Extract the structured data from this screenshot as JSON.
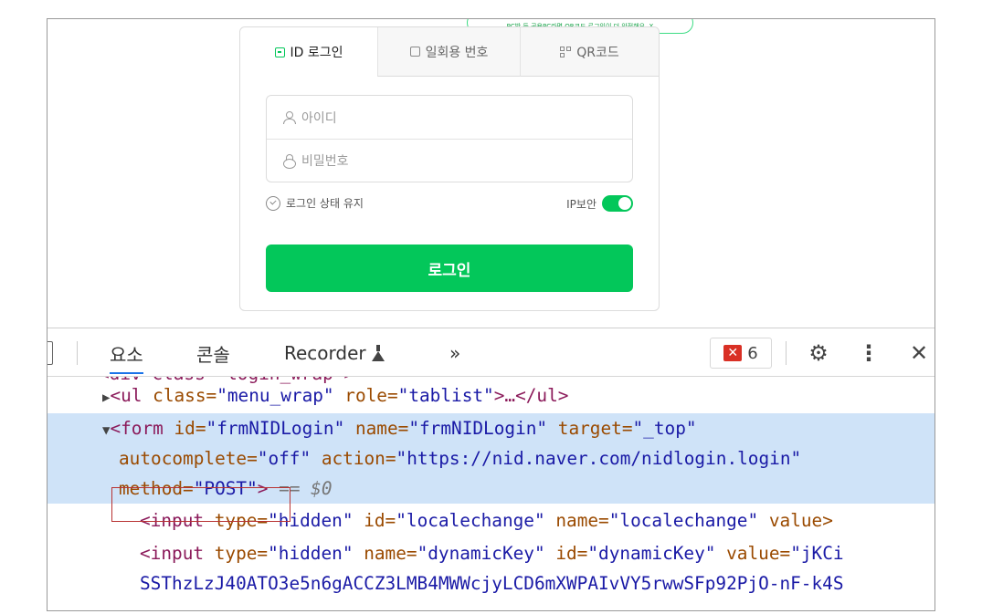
{
  "login": {
    "notice_text": "PC방 등 공용PC라면 QR코드 로그인이 더 안전해요. X",
    "tabs": [
      {
        "label": "ID 로그인",
        "icon": "id-login-icon"
      },
      {
        "label": "일회용 번호",
        "icon": "one-time-number-icon"
      },
      {
        "label": "QR코드",
        "icon": "qr-code-icon"
      }
    ],
    "id_placeholder": "아이디",
    "password_placeholder": "비밀번호",
    "keep_login_label": "로그인 상태 유지",
    "ip_security_label": "IP보안",
    "ip_security_on": true,
    "login_button": "로그인",
    "accent_color": "#03c75a"
  },
  "devtools": {
    "tabs": [
      "요소",
      "콘솔",
      "Recorder",
      "»"
    ],
    "active_tab": "요소",
    "error_count": "6",
    "code": {
      "line0": "<div class=\"login_wrap\">",
      "line1_tag_open": "<ul ",
      "line1_attr1": "class=",
      "line1_val1": "\"menu_wrap\"",
      "line1_attr2": " role=",
      "line1_val2": "\"tablist\"",
      "line1_tag_close": ">…</ul>",
      "line2_tag": "<form ",
      "line2_a1": "id=",
      "line2_v1": "\"frmNIDLogin\"",
      "line2_a2": " name=",
      "line2_v2": "\"frmNIDLogin\"",
      "line2_a3": " target=",
      "line2_v3": "\"_top\"",
      "line3_a1": "autocomplete=",
      "line3_v1": "\"off\"",
      "line3_a2": " action=",
      "line3_v2": "\"https://nid.naver.com/nidlogin.login\"",
      "line4_a1": "method=",
      "line4_v1": "\"POST\"",
      "line4_close": ">",
      "line4_ref": " == $0",
      "line5_tag": "<input ",
      "line5_a1": "type=",
      "line5_v1": "\"hidden\"",
      "line5_a2": " id=",
      "line5_v2": "\"localechange\"",
      "line5_a3": " name=",
      "line5_v3": "\"localechange\"",
      "line5_a4": " value>",
      "line6_tag": "<input ",
      "line6_a1": "type=",
      "line6_v1": "\"hidden\"",
      "line6_a2": " name=",
      "line6_v2": "\"dynamicKey\"",
      "line6_a3": " id=",
      "line6_v3": "\"dynamicKey\"",
      "line6_a4": " value=",
      "line6_v4": "\"jKCi",
      "line7_v": "SSThzLzJ40ATO3e5n6gACCZ3LMB4MWWcjyLCD6mXWPAIvVY5rwwSFp92PjO-nF-k4S"
    }
  }
}
